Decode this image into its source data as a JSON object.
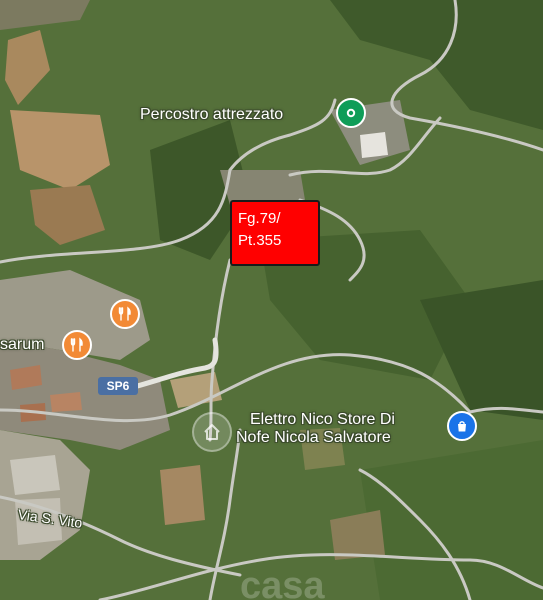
{
  "map": {
    "parcel_label": {
      "line1": "Fg.79/",
      "line2": "Pt.355",
      "color": "#ff0000"
    },
    "places": [
      {
        "name": "Percostro attrezzato",
        "icon": "park-icon",
        "color": "#0f9d58"
      },
      {
        "name_line1": "Elettro Nico Store Di",
        "name_line2": "Nofe Nicola Salvatore",
        "icon": "shopping-bag-icon",
        "color": "#1a73e8"
      },
      {
        "name": "sarum",
        "icon": "restaurant-icon",
        "color": "#f28a36"
      }
    ],
    "restaurant_pin_color": "#f28a36",
    "road_badge": "SP6",
    "street_label": "Via S. Vito",
    "watermark_glyph": "house-icon",
    "watermark_text": "casa"
  }
}
